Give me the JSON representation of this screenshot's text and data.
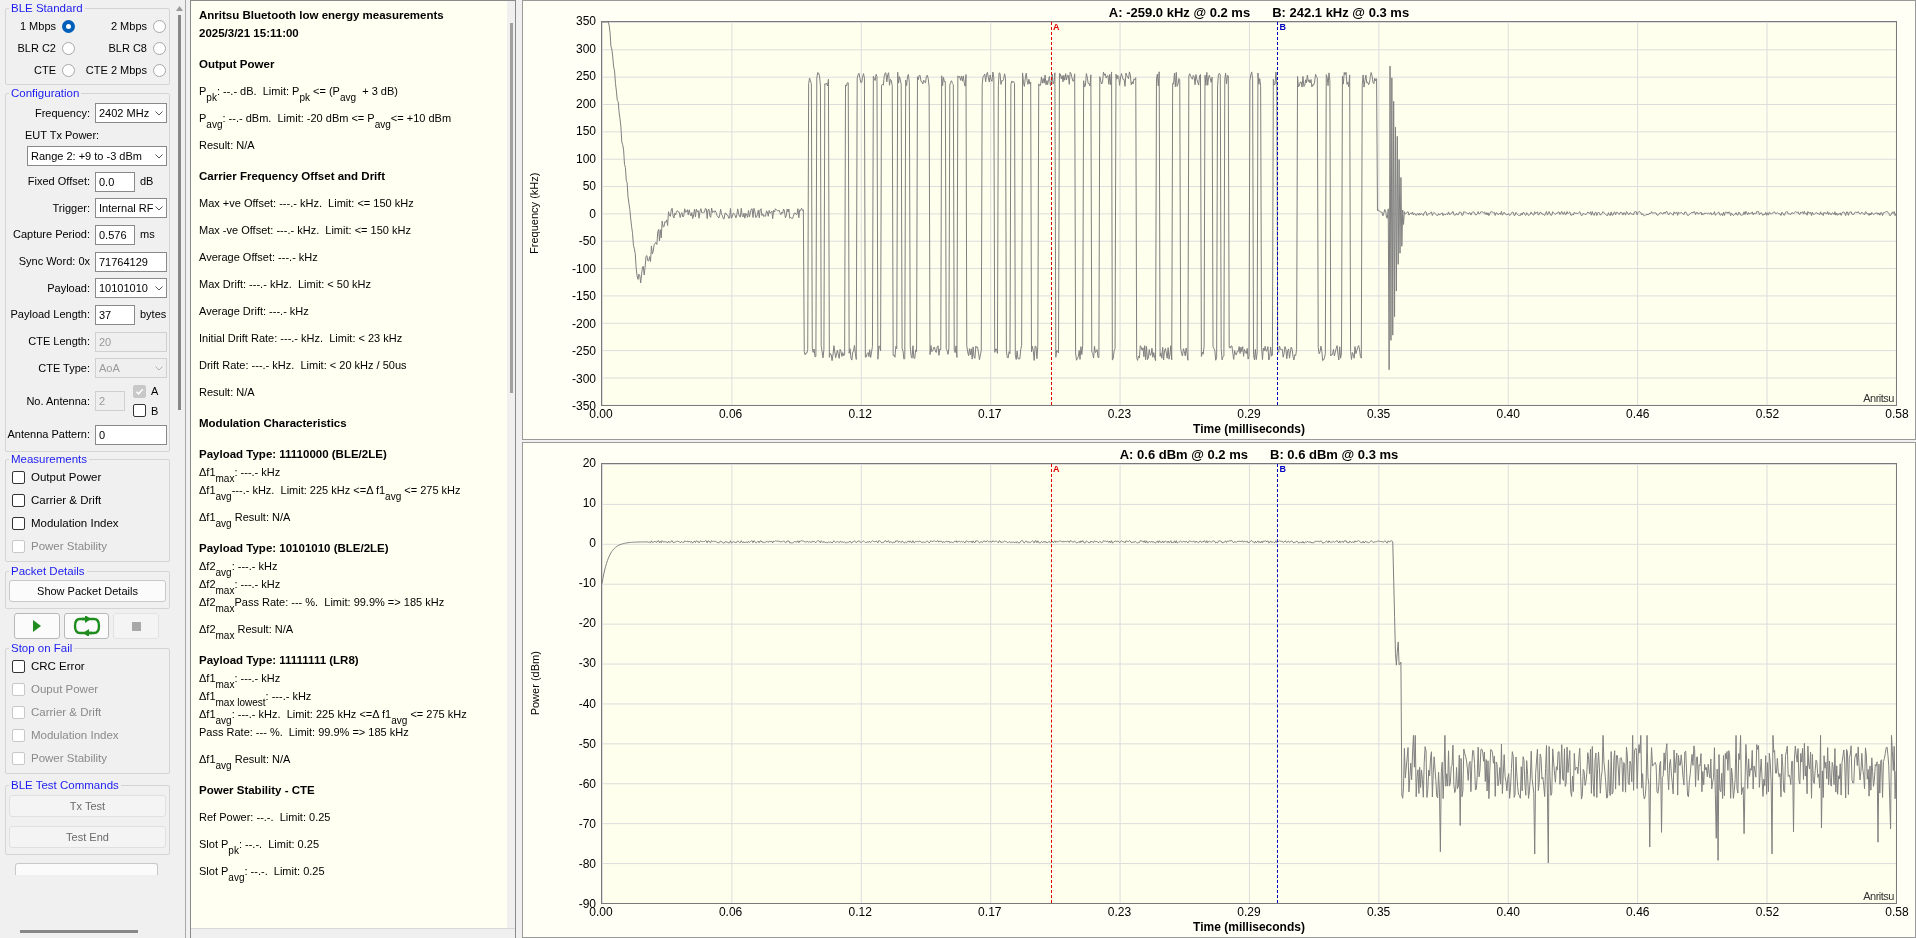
{
  "ble_standard": {
    "title": "BLE Standard",
    "options": [
      {
        "label": "1 Mbps",
        "selected": true
      },
      {
        "label": "2 Mbps",
        "selected": false
      },
      {
        "label": "BLR C2",
        "selected": false
      },
      {
        "label": "BLR C8",
        "selected": false
      },
      {
        "label": "CTE",
        "selected": false
      },
      {
        "label": "CTE 2 Mbps",
        "selected": false
      }
    ]
  },
  "configuration": {
    "title": "Configuration",
    "fields": [
      {
        "kind": "select",
        "label": "Frequency:",
        "value": "2402 MHz",
        "disabled": false
      },
      {
        "kind": "label",
        "label": "EUT Tx Power:"
      },
      {
        "kind": "wide-select",
        "value": "Range 2: +9 to -3 dBm",
        "disabled": false
      },
      {
        "kind": "input",
        "label": "Fixed Offset:",
        "value": "0.0",
        "unit": "dB",
        "disabled": false
      },
      {
        "kind": "select",
        "label": "Trigger:",
        "value": "Internal RF",
        "disabled": false
      },
      {
        "kind": "input",
        "label": "Capture Period:",
        "value": "0.576",
        "unit": "ms",
        "disabled": false
      },
      {
        "kind": "input",
        "label": "Sync Word: 0x",
        "value": "71764129",
        "disabled": false
      },
      {
        "kind": "select",
        "label": "Payload:",
        "value": "10101010",
        "disabled": false
      },
      {
        "kind": "input",
        "label": "Payload Length:",
        "value": "37",
        "unit": "bytes",
        "disabled": false
      },
      {
        "kind": "input",
        "label": "CTE Length:",
        "value": "20",
        "disabled": true
      },
      {
        "kind": "select",
        "label": "CTE Type:",
        "value": "AoA",
        "disabled": true
      },
      {
        "kind": "antenna",
        "label": "No. Antenna:",
        "value": "2",
        "disabled": true,
        "checks": [
          {
            "label": "A",
            "checked": true,
            "disabled": true
          },
          {
            "label": "B",
            "checked": false,
            "disabled": false
          }
        ]
      },
      {
        "kind": "input",
        "label": "Antenna Pattern:",
        "value": "0",
        "disabled": false
      }
    ]
  },
  "measurements": {
    "title": "Measurements",
    "items": [
      {
        "label": "Output Power",
        "checked": false,
        "disabled": false
      },
      {
        "label": "Carrier & Drift",
        "checked": false,
        "disabled": false
      },
      {
        "label": "Modulation Index",
        "checked": false,
        "disabled": false
      },
      {
        "label": "Power Stability",
        "checked": false,
        "disabled": true
      }
    ]
  },
  "packet_details": {
    "title": "Packet Details",
    "button": "Show Packet Details"
  },
  "run_buttons": [
    {
      "kind": "play",
      "disabled": false
    },
    {
      "kind": "loop",
      "disabled": false
    },
    {
      "kind": "stop",
      "disabled": true
    }
  ],
  "stop_on_fail": {
    "title": "Stop on Fail",
    "items": [
      {
        "label": "CRC Error",
        "checked": false,
        "disabled": false
      },
      {
        "label": "Ouput Power",
        "checked": false,
        "disabled": true
      },
      {
        "label": "Carrier & Drift",
        "checked": false,
        "disabled": true
      },
      {
        "label": "Modulation Index",
        "checked": false,
        "disabled": true
      },
      {
        "label": "Power Stability",
        "checked": false,
        "disabled": true
      }
    ]
  },
  "test_commands": {
    "title": "BLE Test Commands",
    "buttons": [
      {
        "label": "Tx Test",
        "disabled": true
      },
      {
        "label": "Test End",
        "disabled": true
      }
    ]
  },
  "report": [
    {
      "kind": "title",
      "text": "Anritsu Bluetooth low energy measurements"
    },
    {
      "kind": "title",
      "text": "2025/3/21 15:11:00"
    },
    {
      "kind": "heading",
      "text": "Output Power"
    },
    {
      "kind": "line",
      "text": "P$_{pk}$: --.- dB.  Limit: P$_{pk}$ <= (P$_{avg}$  + 3 dB)"
    },
    {
      "kind": "line",
      "text": "P$_{avg}$: --.- dBm.  Limit: -20 dBm <= P$_{avg}$<= +10 dBm"
    },
    {
      "kind": "line",
      "text": "Result: N/A"
    },
    {
      "kind": "heading",
      "text": "Carrier Frequency Offset and Drift"
    },
    {
      "kind": "line",
      "text": "Max +ve Offset: ---.- kHz.  Limit: <= 150 kHz"
    },
    {
      "kind": "line",
      "text": "Max -ve Offset: ---.- kHz.  Limit: <= 150 kHz"
    },
    {
      "kind": "line",
      "text": "Average Offset: ---.- kHz"
    },
    {
      "kind": "line",
      "text": "Max Drift: ---.- kHz.  Limit: < 50 kHz"
    },
    {
      "kind": "line",
      "text": "Average Drift: ---.- kHz"
    },
    {
      "kind": "line",
      "text": "Initial Drift Rate: ---.- kHz.  Limit: < 23 kHz"
    },
    {
      "kind": "line",
      "text": "Drift Rate: ---.- kHz.  Limit: < 20 kHz / 50us"
    },
    {
      "kind": "line",
      "text": "Result: N/A"
    },
    {
      "kind": "heading",
      "text": "Modulation Characteristics"
    },
    {
      "kind": "sub",
      "text": "Payload Type: 11110000 (BLE/2LE)"
    },
    {
      "kind": "tight",
      "text": "Δf1$_{max}$: ---.- kHz"
    },
    {
      "kind": "tight",
      "text": "Δf1$_{avg}$---.- kHz.  Limit: 225 kHz <=Δ f1$_{avg}$ <= 275 kHz"
    },
    {
      "kind": "result",
      "text": "Δf1$_{avg}$ Result: N/A"
    },
    {
      "kind": "sub",
      "text": "Payload Type: 10101010 (BLE/2LE)"
    },
    {
      "kind": "tight",
      "text": "Δf2$_{avg}$: ---.- kHz"
    },
    {
      "kind": "tight",
      "text": "Δf2$_{max}$: ---.- kHz"
    },
    {
      "kind": "tight",
      "text": "Δf2$_{max}$Pass Rate: --- %.  Limit: 99.9% => 185 kHz"
    },
    {
      "kind": "result",
      "text": "Δf2$_{max}$ Result: N/A"
    },
    {
      "kind": "sub",
      "text": "Payload Type: 11111111 (LR8)"
    },
    {
      "kind": "tight",
      "text": "Δf1$_{max}$: ---.- kHz"
    },
    {
      "kind": "tight",
      "text": "Δf1$_{max lowest}$: ---.- kHz"
    },
    {
      "kind": "tight",
      "text": "Δf1$_{avg}$: ---.- kHz.  Limit: 225 kHz <=Δ f1$_{avg}$ <= 275 kHz"
    },
    {
      "kind": "tight",
      "text": "Pass Rate: --- %.  Limit: 99.9% => 185 kHz"
    },
    {
      "kind": "result",
      "text": "Δf1$_{avg}$ Result: N/A"
    },
    {
      "kind": "heading",
      "text": "Power Stability - CTE"
    },
    {
      "kind": "line",
      "text": "Ref Power: --.-.  Limit: 0.25"
    },
    {
      "kind": "line",
      "text": "Slot P$_{pk}$: --.-.  Limit: 0.25"
    },
    {
      "kind": "line",
      "text": "Slot P$_{avg}$: --.-.  Limit: 0.25"
    }
  ],
  "frequency_chart": {
    "kind": "frequency",
    "readouts": [
      "A: -259.0 kHz @ 0.2 ms",
      "B: 242.1 kHz @ 0.3 ms"
    ],
    "ylabel": "Frequency (kHz)",
    "yticks": [
      "350",
      "300",
      "250",
      "200",
      "150",
      "100",
      "50",
      "0",
      "-50",
      "-100",
      "-150",
      "-200",
      "-250",
      "-300",
      "-350"
    ],
    "xticks": [
      "0.00",
      "0.06",
      "0.12",
      "0.17",
      "0.23",
      "0.29",
      "0.35",
      "0.40",
      "0.46",
      "0.52",
      "0.58"
    ],
    "xlabel": "Time (milliseconds)",
    "markers": [
      {
        "label": "A",
        "color": "#e00000",
        "level": 0.347
      },
      {
        "label": "B",
        "color": "#0000c0",
        "level": 0.522
      }
    ],
    "brand": "Anritsu"
  },
  "power_chart": {
    "kind": "power",
    "readouts": [
      "A: 0.6 dBm @ 0.2 ms",
      "B: 0.6 dBm @ 0.3 ms"
    ],
    "ylabel": "Power (dBm)",
    "yticks": [
      "20",
      "10",
      "0",
      "-10",
      "-20",
      "-30",
      "-40",
      "-50",
      "-60",
      "-70",
      "-80",
      "-90"
    ],
    "xticks": [
      "0.00",
      "0.06",
      "0.12",
      "0.17",
      "0.23",
      "0.29",
      "0.35",
      "0.40",
      "0.46",
      "0.52",
      "0.58"
    ],
    "xlabel": "Time (milliseconds)",
    "markers": [
      {
        "label": "A",
        "color": "#e00000",
        "level": 0.347
      },
      {
        "label": "B",
        "color": "#0000c0",
        "level": 0.522
      }
    ],
    "brand": "Anritsu"
  }
}
